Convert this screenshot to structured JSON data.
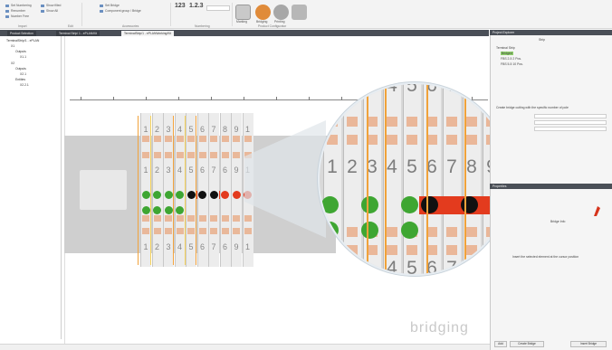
{
  "ribbon": {
    "left_items": [
      "Set Numbering",
      "Renumber",
      "Number Free"
    ],
    "mid_items": [
      "Show filled",
      "Show All"
    ],
    "right_items": [
      "Set Bridge",
      "Component group / Bridge"
    ],
    "numbers": [
      "123",
      "1.2.3"
    ],
    "group_labels": [
      "Import",
      "Edit",
      "Accessories",
      "Numbering",
      "Product Configurator"
    ],
    "big_buttons": [
      "Marking",
      "Bridging",
      "Printing"
    ]
  },
  "tabs": [
    {
      "label": "Product Selection"
    },
    {
      "label": "Terminal Strip/ 1 - ePLAN/Kit"
    },
    {
      "label": "TerminalStrip/1 - ePLANWorking/Kit"
    }
  ],
  "tree": {
    "rows": [
      "TerminalStrip/1 - ePLAN",
      "X1",
      "Outputs",
      "X1.1",
      "X2",
      "Outputs",
      "X2.1",
      "Entities",
      "X2.2.1"
    ]
  },
  "rail": {
    "top_numbers": [
      "1",
      "2",
      "3",
      "4",
      "5",
      "6",
      "7",
      "8",
      "9",
      "1"
    ],
    "mid_numbers": [
      "1",
      "2",
      "3",
      "4",
      "5",
      "6",
      "7",
      "6",
      "9",
      "1"
    ],
    "bottom_numbers": [
      "1",
      "2",
      "3",
      "4",
      "5",
      "6",
      "7",
      "6",
      "9",
      "1"
    ]
  },
  "lens": {
    "top_numbers": [
      "4",
      "5",
      "6",
      "7"
    ],
    "mid_numbers": [
      "1",
      "2",
      "3",
      "4",
      "5",
      "6",
      "7",
      "8",
      "9",
      "1"
    ],
    "last_digit_bottom": "0",
    "bottom_numbers": [
      "4",
      "5",
      "6",
      "7"
    ]
  },
  "watermark": "bridging",
  "right_panel": {
    "top_header": "Project Explorer",
    "top_tab": "Strip",
    "tree_rows": [
      "Terminal Strip",
      "Bridged",
      "FBS 2-5 2 Pos.",
      "FBS 5-5 10 Pos."
    ],
    "desc": "Create bridge cutting with the specific number of pole",
    "fields": [
      "",
      "",
      ""
    ],
    "bottom_header": "Properties",
    "bottom_label": "Bridge Info",
    "bottom_desc": "Insert the selected element at the cursor position",
    "buttons": [
      "Add",
      "Create Bridge",
      "Insert Bridge"
    ]
  },
  "colors": {
    "ribbon_bg": "#f3f3f3",
    "accent_green": "#3ea632",
    "accent_red": "#e33b1e",
    "accent_black": "#111111",
    "pin_color": "#eab799",
    "orange_line": "#f0a23a"
  }
}
